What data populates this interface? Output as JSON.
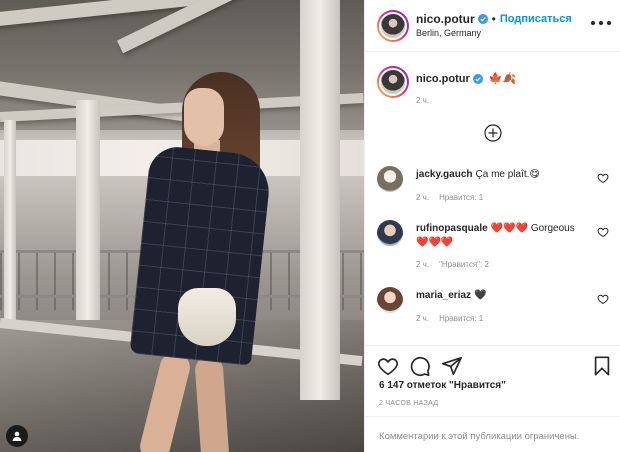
{
  "post": {
    "username": "nico.potur",
    "follow_label": "Подписаться",
    "location": "Berlin, Germany",
    "caption_emoji": "🍁🍂",
    "caption_time": "2 ч.",
    "likes_text": "6 147 отметок \"Нравится\"",
    "posted_ago": "2 ЧАСОВ НАЗАД",
    "comments_disabled": "Комментарии к этой публикации ограничены."
  },
  "comments": [
    {
      "user": "jacky.gauch",
      "text": "Ça me plaît.😋",
      "time": "2 ч.",
      "likes": "Нравится: 1"
    },
    {
      "user": "rufinopasquale",
      "text": "❤️❤️❤️ Gorgeous❤️❤️❤️",
      "time": "2 ч.",
      "likes": "\"Нравится\": 2"
    },
    {
      "user": "maria_eriaz",
      "text": "🖤",
      "time": "2 ч.",
      "likes": "Нравится: 1"
    }
  ],
  "colors": {
    "accent": "#0095f6",
    "verified": "#3897f0",
    "muted": "#8e8e8e",
    "text": "#262626"
  },
  "icons": [
    "verified-badge-icon",
    "more-options-icon",
    "load-more-comments-icon",
    "heart-icon",
    "comment-icon",
    "share-icon",
    "bookmark-icon",
    "user-tags-icon"
  ]
}
